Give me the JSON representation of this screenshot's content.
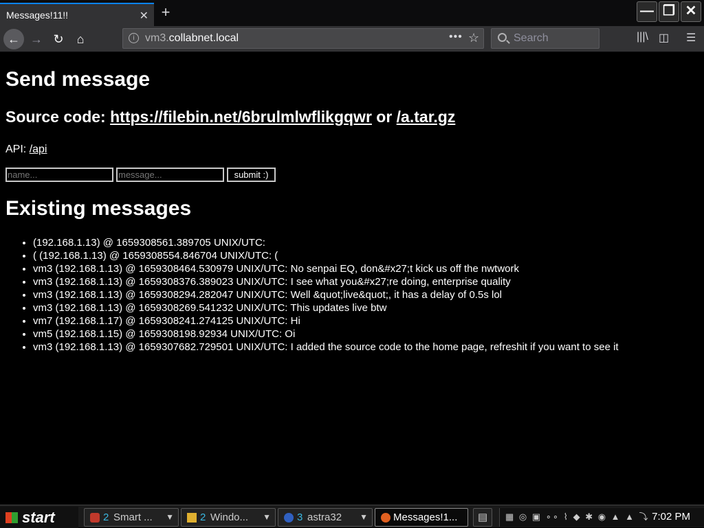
{
  "browser": {
    "tab_title": "Messages!11!!",
    "url_prefix": "vm3.",
    "url_domain": "collabnet.local",
    "search_placeholder": "Search"
  },
  "page": {
    "heading": "Send message",
    "source_label": "Source code:",
    "source_link": "https://filebin.net/6brulmlwflikgqwr",
    "source_or": "or",
    "tar_link": "/a.tar.gz",
    "api_label": "API:",
    "api_link": "/api",
    "name_placeholder": "name...",
    "message_placeholder": "message...",
    "submit_label": "submit :)",
    "messages_heading": "Existing messages",
    "messages": [
      "(192.168.1.13) @ 1659308561.389705 UNIX/UTC:",
      "( (192.168.1.13) @ 1659308554.846704 UNIX/UTC: (",
      "vm3 (192.168.1.13) @ 1659308464.530979 UNIX/UTC: No senpai EQ, don&#x27;t kick us off the nwtwork",
      "vm3 (192.168.1.13) @ 1659308376.389023 UNIX/UTC: I see what you&#x27;re doing, enterprise quality",
      "vm3 (192.168.1.13) @ 1659308294.282047 UNIX/UTC: Well &quot;live&quot;, it has a delay of 0.5s lol",
      "vm3 (192.168.1.13) @ 1659308269.541232 UNIX/UTC: This updates live btw",
      "vm7 (192.168.1.17) @ 1659308241.274125 UNIX/UTC: Hi",
      "vm5 (192.168.1.15) @ 1659308198.92934 UNIX/UTC: Oi",
      "vm3 (192.168.1.13) @ 1659307682.729501 UNIX/UTC: I added the source code to the home page, refreshit if you want to see it"
    ]
  },
  "taskbar": {
    "start_label": "start",
    "tasks": [
      {
        "count": "2",
        "label": "Smart ..."
      },
      {
        "count": "2",
        "label": "Windo..."
      },
      {
        "count": "3",
        "label": "astra32"
      },
      {
        "count": "",
        "label": "Messages!1..."
      }
    ],
    "clock": "7:02 PM"
  },
  "colors": {
    "accent": "#0a84ff",
    "page_bg": "#000000",
    "toolbar_bg": "#323234"
  }
}
